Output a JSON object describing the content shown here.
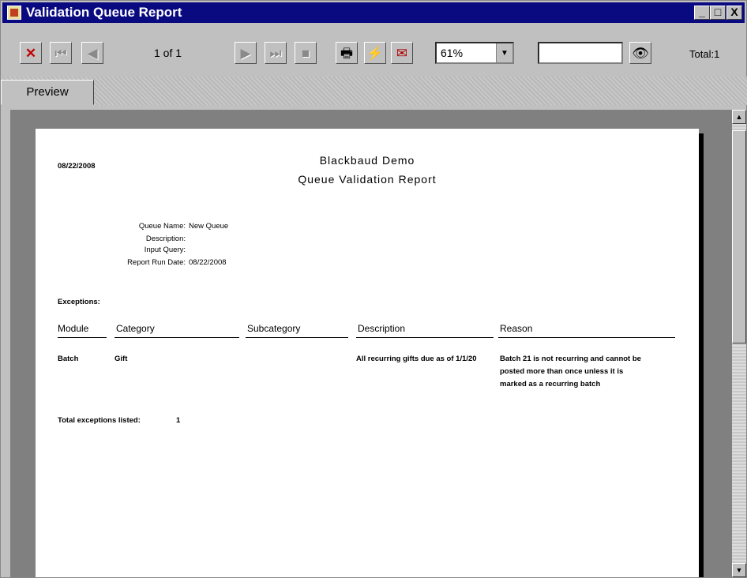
{
  "window": {
    "title": "Validation Queue Report"
  },
  "title_buttons": {
    "minimize": "_",
    "maximize": "□",
    "close": "X"
  },
  "toolbar": {
    "page_indicator": "1 of 1",
    "zoom_value": "61%",
    "search_value": "",
    "total_label": "Total:1",
    "icons": [
      "close-icon",
      "first-page-icon",
      "prev-page-icon",
      "next-page-icon",
      "last-page-icon",
      "stop-icon",
      "print-icon",
      "refresh-icon",
      "export-icon",
      "dropdown-arrow-icon",
      "binoculars-icon"
    ]
  },
  "tab": {
    "label": "Preview"
  },
  "report": {
    "date": "08/22/2008",
    "title": "Blackbaud Demo",
    "subtitle": "Queue Validation Report",
    "meta": [
      {
        "label": "Queue Name:",
        "value": "New Queue"
      },
      {
        "label": "Description:",
        "value": ""
      },
      {
        "label": "Input Query:",
        "value": ""
      },
      {
        "label": "Report Run Date:",
        "value": "08/22/2008"
      }
    ],
    "exceptions_label": "Exceptions:",
    "columns": [
      "Module",
      "Category",
      "Subcategory",
      "Description",
      "Reason"
    ],
    "rows": [
      {
        "module": "Batch",
        "category": "Gift",
        "subcategory": "",
        "description": "All recurring gifts due as of 1/1/20",
        "reason_lines": [
          "Batch 21 is not recurring and cannot be",
          "posted more than once unless it is",
          "marked as a recurring batch"
        ]
      }
    ],
    "total_label": "Total exceptions listed:",
    "total_value": "1"
  }
}
